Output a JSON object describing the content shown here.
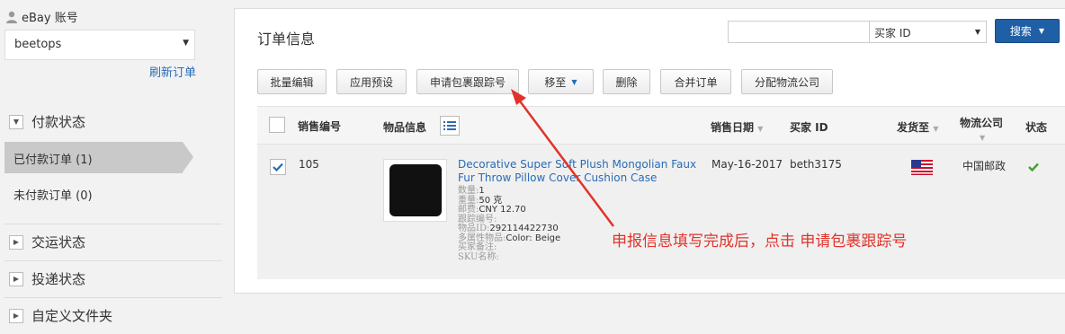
{
  "sidebar": {
    "account_label": "eBay 账号",
    "account_value": "beetops",
    "refresh_label": "刷新订单",
    "payment_status": {
      "title": "付款状态",
      "items": [
        {
          "label": "已付款订单 (1)",
          "active": true
        },
        {
          "label": "未付款订单 (0)",
          "active": false
        }
      ]
    },
    "sections": [
      {
        "label": "交运状态"
      },
      {
        "label": "投递状态"
      },
      {
        "label": "自定义文件夹"
      }
    ]
  },
  "main": {
    "title": "订单信息",
    "search": {
      "placeholder": "",
      "type_value": "买家 ID",
      "button_label": "搜索"
    },
    "toolbar": {
      "batch_edit": "批量编辑",
      "apply_preset": "应用预设",
      "request_tracking": "申请包裹跟踪号",
      "move_to": "移至",
      "delete": "删除",
      "merge_orders": "合并订单",
      "assign_carrier": "分配物流公司"
    },
    "table": {
      "headers": {
        "sale_no": "销售编号",
        "item_info": "物品信息",
        "sale_date": "销售日期",
        "buyer_id": "买家 ID",
        "ship_to": "发货至",
        "carrier": "物流公司",
        "status": "状态"
      },
      "rows": [
        {
          "checked": true,
          "sale_no": "105",
          "title": "Decorative Super Soft Plush Mongolian Faux Fur Throw Pillow Cover Cushion Case",
          "details": [
            {
              "label": "数量:",
              "value": "1"
            },
            {
              "label": "重量:",
              "value": "50 克"
            },
            {
              "label": "邮费:",
              "value": "CNY 12.70"
            },
            {
              "label": "跟踪编号:",
              "value": ""
            },
            {
              "label": "物品ID:",
              "value": "292114422730"
            },
            {
              "label": "多属性物品:",
              "value": "Color: Beige"
            },
            {
              "label": "买家备注:",
              "value": ""
            },
            {
              "label": "SKU名称:",
              "value": ""
            }
          ],
          "sale_date": "May-16-2017",
          "buyer_id": "beth3175",
          "ship_to_icon": "us-flag-icon",
          "carrier": "中国邮政",
          "status_icon": "check-icon"
        }
      ]
    }
  },
  "annotation": {
    "text": "申报信息填写完成后，点击 申请包裹跟踪号",
    "color": "#e0342b"
  },
  "colors": {
    "link": "#2a6bb5",
    "primary_button": "#1f5fa6",
    "active_nav": "#c9c9c9",
    "success": "#4a9e2f"
  }
}
